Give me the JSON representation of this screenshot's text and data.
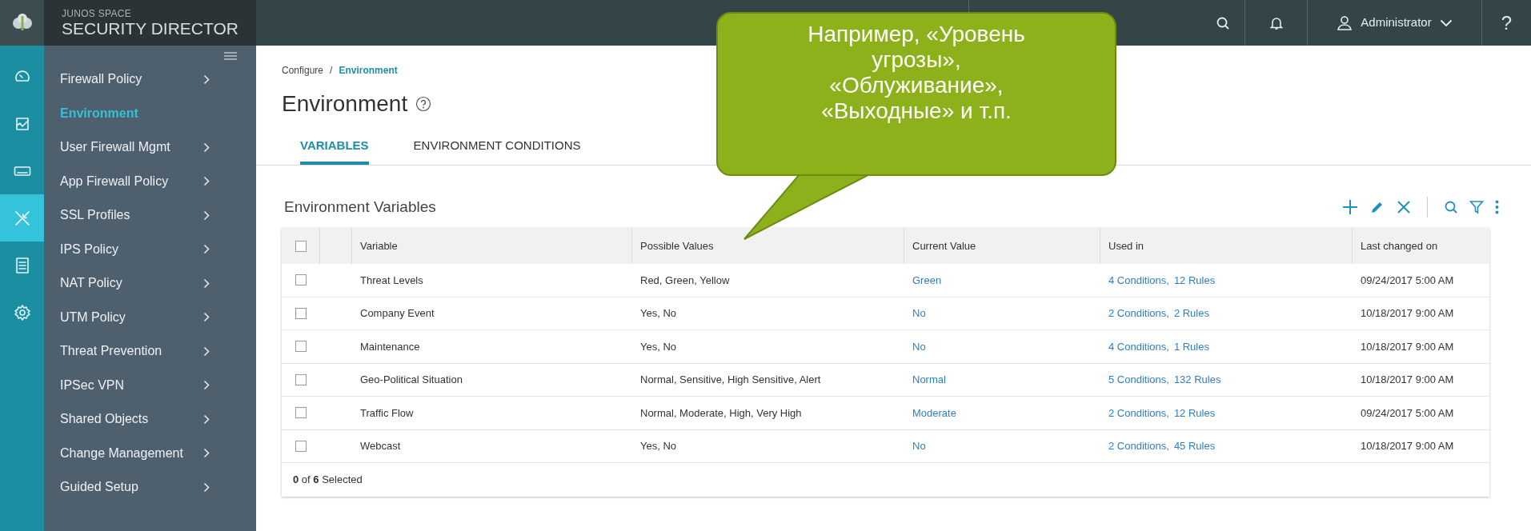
{
  "brand": {
    "line1": "JUNOS SPACE",
    "line2": "SECURITY DIRECTOR"
  },
  "topbar": {
    "user": "Administrator",
    "help": "?"
  },
  "rail": [
    {
      "kind": "dashboard",
      "selected": false
    },
    {
      "kind": "monitor",
      "selected": false
    },
    {
      "kind": "devices",
      "selected": false
    },
    {
      "kind": "configure",
      "selected": true
    },
    {
      "kind": "reports",
      "selected": false
    },
    {
      "kind": "administration",
      "selected": false
    }
  ],
  "sidebar": {
    "items": [
      {
        "label": "Firewall Policy",
        "selected": false
      },
      {
        "label": "Environment",
        "selected": true
      },
      {
        "label": "User Firewall Mgmt",
        "selected": false
      },
      {
        "label": "App Firewall Policy",
        "selected": false
      },
      {
        "label": "SSL Profiles",
        "selected": false
      },
      {
        "label": "IPS Policy",
        "selected": false
      },
      {
        "label": "NAT Policy",
        "selected": false
      },
      {
        "label": "UTM Policy",
        "selected": false
      },
      {
        "label": "Threat Prevention",
        "selected": false
      },
      {
        "label": "IPSec VPN",
        "selected": false
      },
      {
        "label": "Shared Objects",
        "selected": false
      },
      {
        "label": "Change Management",
        "selected": false
      },
      {
        "label": "Guided Setup",
        "selected": false
      }
    ]
  },
  "breadcrumb": {
    "parent": "Configure",
    "separator": "/",
    "current": "Environment"
  },
  "page_title": "Environment",
  "tabs": [
    {
      "label": "VARIABLES",
      "selected": true
    },
    {
      "label": "ENVIRONMENT CONDITIONS",
      "selected": false
    }
  ],
  "grid_title": "Environment Variables",
  "table": {
    "all_checked": false,
    "columns": [
      "Variable",
      "Possible Values",
      "Current Value",
      "Used in",
      "Last changed on"
    ],
    "rows": [
      {
        "checked": false,
        "variable": "Threat Levels",
        "possible": "Red, Green, Yellow",
        "current": "Green",
        "conditions": "4 Conditions,",
        "rules": "12 Rules",
        "changed": "09/24/2017 5:00 AM"
      },
      {
        "checked": false,
        "variable": "Company Event",
        "possible": "Yes, No",
        "current": "No",
        "conditions": "2 Conditions,",
        "rules": "2 Rules",
        "changed": "10/18/2017 9:00 AM"
      },
      {
        "checked": false,
        "variable": "Maintenance",
        "possible": "Yes, No",
        "current": "No",
        "conditions": "4 Conditions,",
        "rules": "1 Rules",
        "changed": "10/18/2017 9:00 AM"
      },
      {
        "checked": false,
        "variable": "Geo-Political Situation",
        "possible": "Normal, Sensitive, High Sensitive, Alert",
        "current": "Normal",
        "conditions": "5 Conditions,",
        "rules": "132 Rules",
        "changed": "10/18/2017 9:00 AM"
      },
      {
        "checked": false,
        "variable": "Traffic Flow",
        "possible": "Normal, Moderate, High, Very High",
        "current": "Moderate",
        "conditions": "2 Conditions,",
        "rules": "12 Rules",
        "changed": "09/24/2017 5:00 AM"
      },
      {
        "checked": false,
        "variable": "Webcast",
        "possible": "Yes, No",
        "current": "No",
        "conditions": "2 Conditions,",
        "rules": "45 Rules",
        "changed": "10/18/2017 9:00 AM"
      }
    ],
    "footer": "**0** of **6** Selected"
  },
  "callout": "Например, «Уровень угрозы», «Облуживание», «Выходные» и т.п."
}
